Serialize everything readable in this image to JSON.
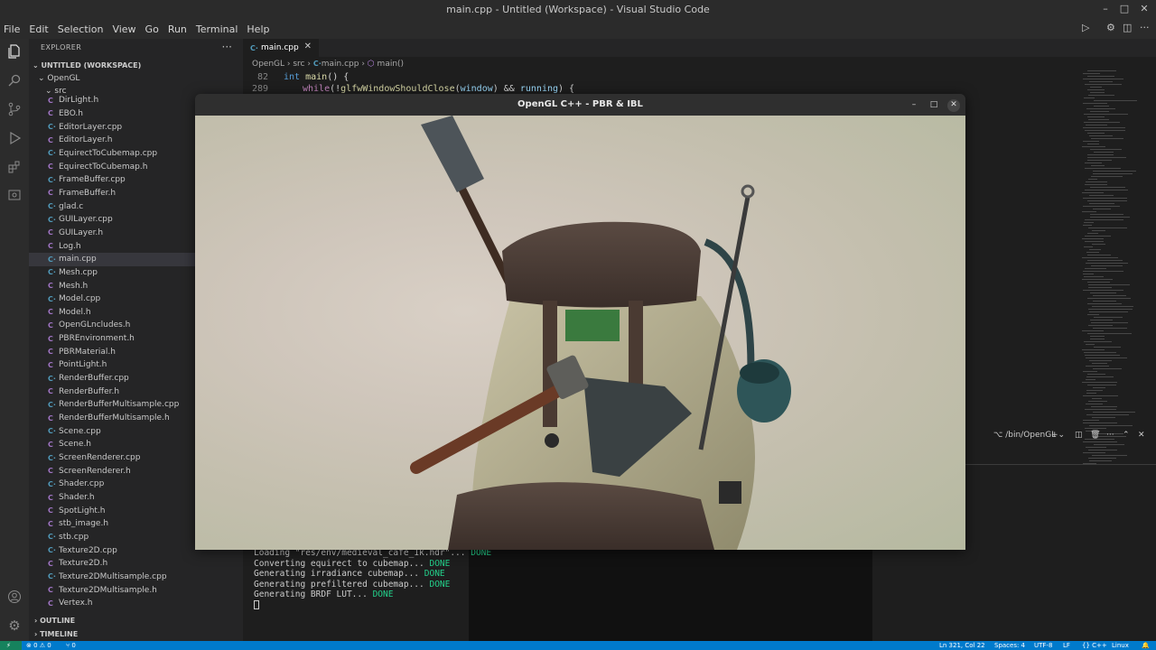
{
  "window": {
    "title": "main.cpp - Untitled (Workspace) - Visual Studio Code"
  },
  "menu": [
    "File",
    "Edit",
    "Selection",
    "View",
    "Go",
    "Run",
    "Terminal",
    "Help"
  ],
  "sidebar": {
    "header": "EXPLORER",
    "workspace": "UNTITLED (WORKSPACE)",
    "folder": "OpenGL",
    "subfolder": "src",
    "files": [
      {
        "name": "DirLight.h",
        "type": "h"
      },
      {
        "name": "EBO.h",
        "type": "h"
      },
      {
        "name": "EditorLayer.cpp",
        "type": "cpp"
      },
      {
        "name": "EditorLayer.h",
        "type": "h"
      },
      {
        "name": "EquirectToCubemap.cpp",
        "type": "cpp"
      },
      {
        "name": "EquirectToCubemap.h",
        "type": "h"
      },
      {
        "name": "FrameBuffer.cpp",
        "type": "cpp"
      },
      {
        "name": "FrameBuffer.h",
        "type": "h"
      },
      {
        "name": "glad.c",
        "type": "c"
      },
      {
        "name": "GUILayer.cpp",
        "type": "cpp"
      },
      {
        "name": "GUILayer.h",
        "type": "h"
      },
      {
        "name": "Log.h",
        "type": "h"
      },
      {
        "name": "main.cpp",
        "type": "cpp",
        "selected": true
      },
      {
        "name": "Mesh.cpp",
        "type": "cpp"
      },
      {
        "name": "Mesh.h",
        "type": "h"
      },
      {
        "name": "Model.cpp",
        "type": "cpp"
      },
      {
        "name": "Model.h",
        "type": "h"
      },
      {
        "name": "OpenGLncludes.h",
        "type": "h"
      },
      {
        "name": "PBREnvironment.h",
        "type": "h"
      },
      {
        "name": "PBRMaterial.h",
        "type": "h"
      },
      {
        "name": "PointLight.h",
        "type": "h"
      },
      {
        "name": "RenderBuffer.cpp",
        "type": "cpp"
      },
      {
        "name": "RenderBuffer.h",
        "type": "h"
      },
      {
        "name": "RenderBufferMultisample.cpp",
        "type": "cpp"
      },
      {
        "name": "RenderBufferMultisample.h",
        "type": "h"
      },
      {
        "name": "Scene.cpp",
        "type": "cpp"
      },
      {
        "name": "Scene.h",
        "type": "h"
      },
      {
        "name": "ScreenRenderer.cpp",
        "type": "cpp"
      },
      {
        "name": "ScreenRenderer.h",
        "type": "h"
      },
      {
        "name": "Shader.cpp",
        "type": "cpp"
      },
      {
        "name": "Shader.h",
        "type": "h"
      },
      {
        "name": "SpotLight.h",
        "type": "h"
      },
      {
        "name": "stb_image.h",
        "type": "h"
      },
      {
        "name": "stb.cpp",
        "type": "cpp"
      },
      {
        "name": "Texture2D.cpp",
        "type": "cpp"
      },
      {
        "name": "Texture2D.h",
        "type": "h"
      },
      {
        "name": "Texture2DMultisample.cpp",
        "type": "cpp"
      },
      {
        "name": "Texture2DMultisample.h",
        "type": "h"
      },
      {
        "name": "Vertex.h",
        "type": "h"
      }
    ],
    "outline": "OUTLINE",
    "timeline": "TIMELINE"
  },
  "editor": {
    "tab": "main.cpp",
    "breadcrumb": [
      "OpenGL",
      "src",
      "main.cpp",
      "main()"
    ],
    "lines": [
      {
        "num": "82",
        "code": "int main() {"
      },
      {
        "num": "289",
        "code": "while(!glfwWindowShouldClose(window) && running) {"
      }
    ]
  },
  "terminal": {
    "shell_label": "/bin/OpenGL",
    "lines": [
      {
        "text": "Loading \"res/env/medieval_cafe_1k.hdr\"... ",
        "status": "DONE"
      },
      {
        "text": "Converting equirect to cubemap... ",
        "status": "DONE"
      },
      {
        "text": "Generating irradiance cubemap... ",
        "status": "DONE"
      },
      {
        "text": "Generating prefiltered cubemap... ",
        "status": "DONE"
      },
      {
        "text": "Generating BRDF LUT... ",
        "status": "DONE"
      }
    ]
  },
  "statusbar": {
    "problems": "⊗ 0 ⚠ 0",
    "ports": "⑂ 0",
    "position": "Ln 321, Col 22",
    "spaces": "Spaces: 4",
    "encoding": "UTF-8",
    "eol": "LF",
    "language": "{} C++",
    "os": "Linux"
  },
  "gl_window": {
    "title": "OpenGL C++ - PBR & IBL"
  }
}
